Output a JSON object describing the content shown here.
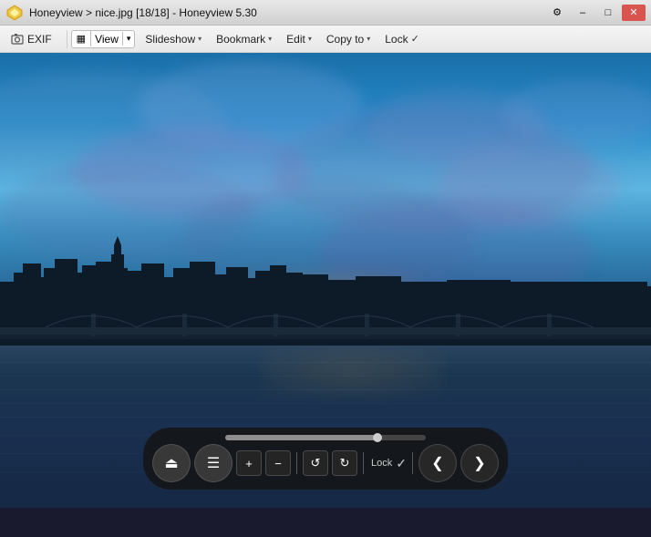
{
  "titleBar": {
    "appName": "Honeyview",
    "filePath": "nice.jpg [18/18]",
    "fullTitle": "Honeyview > nice.jpg [18/18] - Honeyview 5.30",
    "windowControls": {
      "minimize": "–",
      "maximize": "□",
      "close": "✕"
    }
  },
  "menuBar": {
    "exif": "EXIF",
    "viewGroup": {
      "icon": "▦",
      "label": "View",
      "arrow": "▾"
    },
    "slideshow": "Slideshow",
    "slideshowArrow": "▾",
    "bookmark": "Bookmark",
    "bookmarkArrow": "▾",
    "edit": "Edit",
    "editArrow": "▾",
    "copyTo": "Copy to",
    "copyToArrow": "▾",
    "lock": "Lock",
    "lockCheck": "✓"
  },
  "controls": {
    "ejectBtn": "⏏",
    "menuBtn": "☰",
    "zoomIn": "+",
    "zoomOut": "−",
    "rotateLeft": "↺",
    "rotateRight": "↻",
    "lockLabel": "Lock",
    "lockCheck": "✓",
    "prevBtn": "❮",
    "nextBtn": "❯"
  },
  "image": {
    "filename": "nice.jpg",
    "index": "18/18"
  }
}
